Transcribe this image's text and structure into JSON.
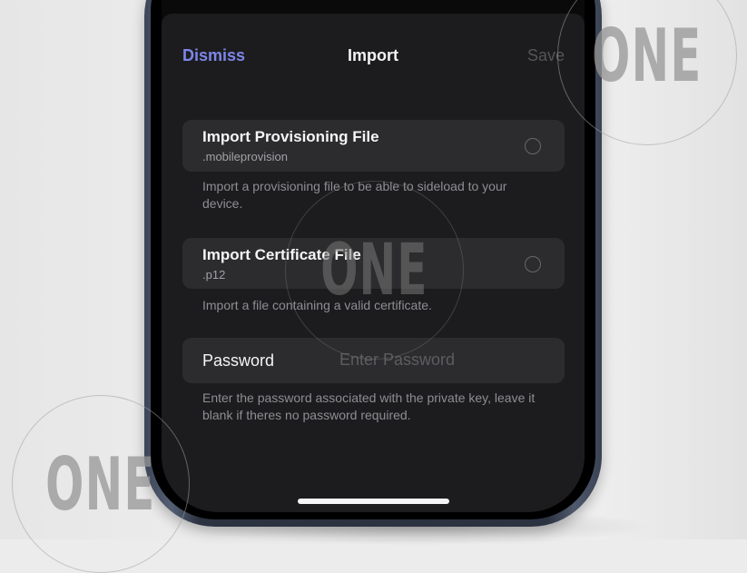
{
  "nav": {
    "dismiss": "Dismiss",
    "title": "Import",
    "save": "Save"
  },
  "provisioning": {
    "title": "Import Provisioning File",
    "subtitle": ".mobileprovision",
    "footnote": "Import a provisioning file to be able to sideload to your device."
  },
  "certificate": {
    "title": "Import Certificate File",
    "subtitle": ".p12",
    "footnote": "Import a file containing a valid certificate."
  },
  "password": {
    "label": "Password",
    "placeholder": "Enter Password",
    "value": "",
    "footnote": "Enter the password associated with the private key, leave it blank if theres no password required."
  },
  "watermark": {
    "text": "ONE"
  },
  "colors": {
    "accent": "#7d86e8",
    "sheet_bg": "#1c1c1e",
    "card_bg": "#2c2c2e"
  }
}
